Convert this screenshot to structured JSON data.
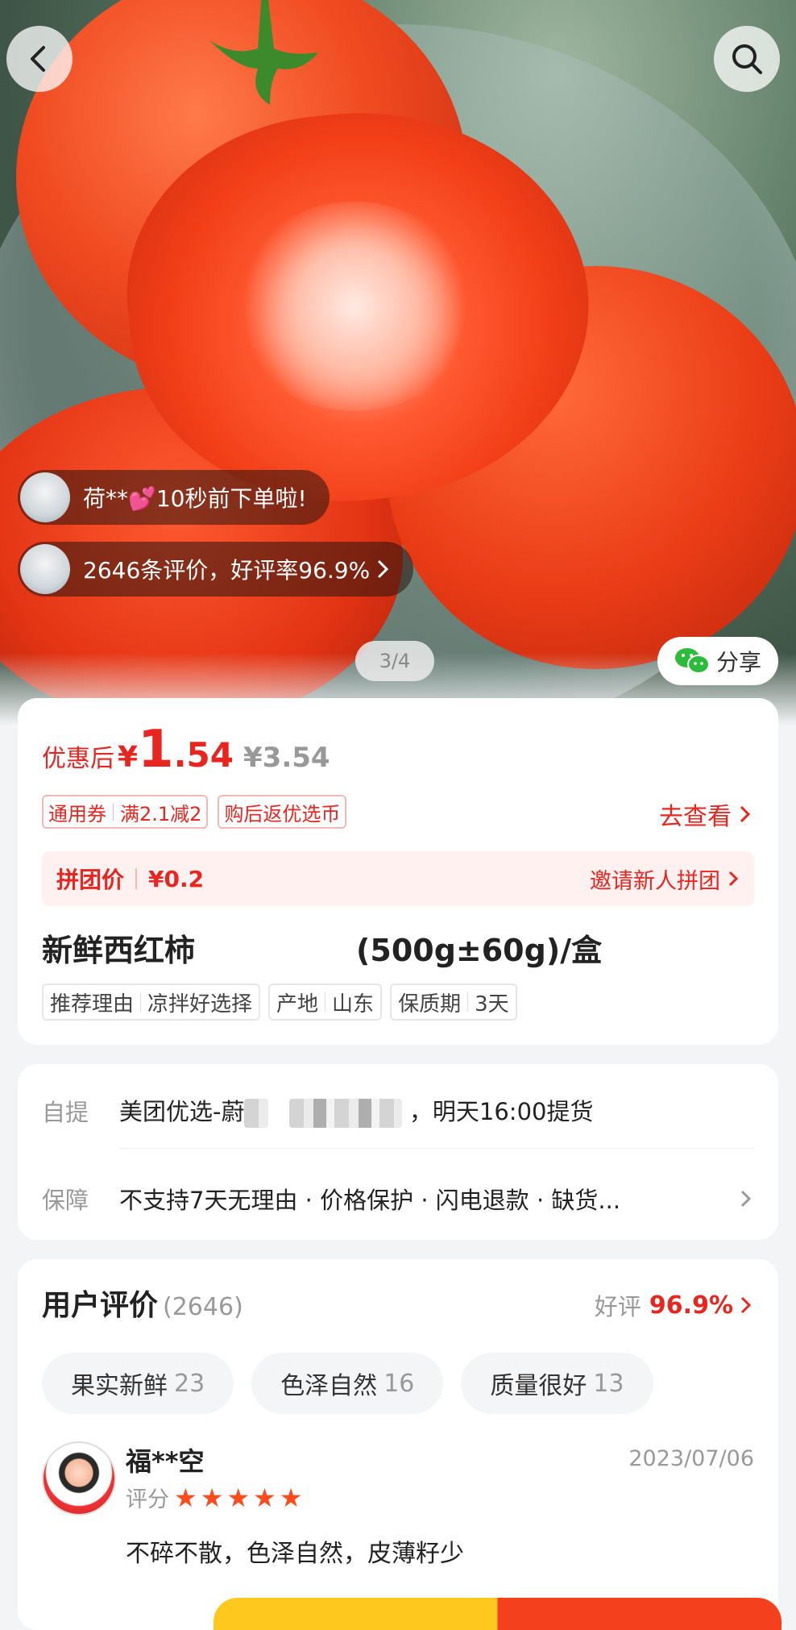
{
  "hero": {
    "order_notice": "荷**💕10秒前下单啦!",
    "review_notice": "2646条评价，好评率96.9%",
    "image_counter": "3/4",
    "share_label": "分享"
  },
  "price": {
    "label": "优惠后",
    "currency": "¥",
    "int": "1",
    "dec": ".54",
    "original": "¥3.54"
  },
  "coupon": {
    "tag1_a": "通用券",
    "tag1_b": "满2.1减2",
    "tag2": "购后返优选币",
    "goto": "去查看"
  },
  "group": {
    "label": "拼团价",
    "price": "¥0.2",
    "invite": "邀请新人拼团"
  },
  "product": {
    "name": "新鲜西红柿",
    "spec": "(500g±60g)/盒",
    "attrs": [
      {
        "k": "推荐理由",
        "v": "凉拌好选择"
      },
      {
        "k": "产地",
        "v": "山东"
      },
      {
        "k": "保质期",
        "v": "3天"
      }
    ]
  },
  "service": {
    "pickup_key": "自提",
    "pickup_prefix": "美团优选-蔚",
    "pickup_suffix": "，明天16:00提货",
    "guarantee_key": "保障",
    "guarantee_val": "不支持7天无理由 · 价格保护 · 闪电退款 · 缺货..."
  },
  "reviews": {
    "title": "用户评价",
    "count": "(2646)",
    "rate_label": "好评",
    "rate_value": "96.9%",
    "chips": [
      {
        "label": "果实新鲜",
        "n": "23"
      },
      {
        "label": "色泽自然",
        "n": "16"
      },
      {
        "label": "质量很好",
        "n": "13"
      }
    ],
    "first": {
      "user": "福**空",
      "date": "2023/07/06",
      "score_label": "评分",
      "stars": 5,
      "text": "不碎不散，色泽自然，皮薄籽少"
    }
  },
  "colors": {
    "accent": "#e8251f",
    "star": "#ff4a1e"
  }
}
